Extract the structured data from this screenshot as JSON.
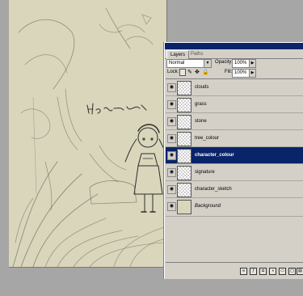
{
  "layers_panel": {
    "tabs": [
      {
        "label": "Layers"
      },
      {
        "label": "Paths"
      }
    ],
    "blend_mode": "Normal",
    "opacity_label": "Opacity:",
    "opacity_value": "100%",
    "lock_label": "Lock:",
    "fill_label": "Fill:",
    "fill_value": "100%",
    "layers": [
      {
        "name": "clouds",
        "selected": false,
        "italic": false
      },
      {
        "name": "grass",
        "selected": false,
        "italic": false
      },
      {
        "name": "stone",
        "selected": false,
        "italic": false
      },
      {
        "name": "tree_colour",
        "selected": false,
        "italic": false
      },
      {
        "name": "character_colour",
        "selected": true,
        "italic": false
      },
      {
        "name": "signature",
        "selected": false,
        "italic": false
      },
      {
        "name": "character_sketch",
        "selected": false,
        "italic": false
      },
      {
        "name": "Background",
        "selected": false,
        "italic": true
      }
    ]
  },
  "icons": {
    "visibility": "eye-icon",
    "lock_transparency": "lock-transparent-icon",
    "lock_image": "brush-icon",
    "lock_position": "move-icon",
    "lock_all": "lock-icon",
    "bottom": [
      "link-icon",
      "fx-icon",
      "mask-icon",
      "adjustment-icon",
      "folder-icon",
      "new-layer-icon",
      "trash-icon"
    ]
  },
  "colors": {
    "selection": "#0a246a",
    "panel_bg": "#d4d0c8",
    "canvas_bg": "#d9d6bc"
  }
}
